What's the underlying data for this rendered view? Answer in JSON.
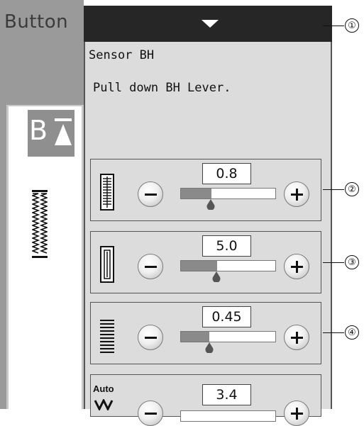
{
  "left_panel": {
    "title": "Button",
    "selected_icon": "bh-sensor-buttonhole-icon",
    "stitch_icon": "buttonhole-stitch-icon"
  },
  "top_bar": {
    "icon": "dropdown-arrow-icon"
  },
  "message": {
    "line1": "Sensor BH",
    "line2": "Pull down BH Lever."
  },
  "rows": [
    {
      "icon": "stitch-width-icon",
      "value": "0.8",
      "slider_fraction": 0.32
    },
    {
      "icon": "stitch-length-icon",
      "value": "5.0",
      "slider_fraction": 0.38
    },
    {
      "icon": "stitch-density-icon",
      "value": "0.45",
      "slider_fraction": 0.3
    },
    {
      "icon": "auto-lock-icon",
      "label": "Auto",
      "value": "3.4"
    }
  ],
  "callouts": [
    "①",
    "②",
    "③",
    "④"
  ],
  "colors": {
    "top_bar": "#262626",
    "panel": "#dcdcdc",
    "slider_fill": "#8a8a8a"
  }
}
